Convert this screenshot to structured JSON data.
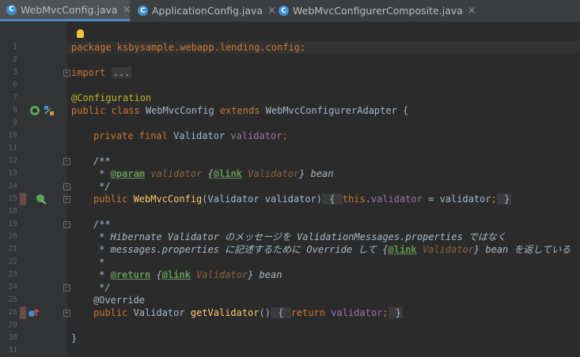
{
  "tabs": [
    {
      "label": "WebMvcConfig.java",
      "active": true,
      "closable": true,
      "icon": "class-icon"
    },
    {
      "label": "ApplicationConfig.java",
      "active": false,
      "closable": true,
      "icon": "class-icon"
    },
    {
      "label": "WebMvcConfigurerComposite.java",
      "active": false,
      "closable": true,
      "icon": "class-icon"
    }
  ],
  "colors": {
    "keyword": "#cc7832",
    "annotation": "#bbb529",
    "field": "#9876aa",
    "method": "#ffc66d",
    "javadoc": "#629755",
    "text": "#a9b7c6",
    "background": "#2b2b2b"
  },
  "line_numbers": [
    "1",
    "2",
    "3",
    "6",
    "7",
    "8",
    "9",
    "10",
    "11",
    "12",
    "13",
    "14",
    "15",
    "18",
    "19",
    "20",
    "21",
    "22",
    "23",
    "24",
    "25",
    "26",
    "29",
    "30",
    "31"
  ],
  "code": {
    "l1": {
      "package_kw": "package",
      "package_name": " ksbysample.webapp.lending.config;"
    },
    "l3": {
      "import_kw": "import",
      "folded": "..."
    },
    "l7": {
      "annotation": "@Configuration"
    },
    "l8": {
      "public": "public",
      "class": " class",
      "name": " WebMvcConfig",
      "extends": " extends",
      "parent": " WebMvcConfigurerAdapter {"
    },
    "l10": {
      "private": "private",
      "final": " final",
      "type": " Validator",
      "field": " validator",
      "semi": ";"
    },
    "l12": {
      "text": "/**"
    },
    "l13": {
      "star": " * ",
      "tag": "@param",
      "param": " validator ",
      "link_open": "{",
      "link_tag": "@link",
      "link_ref": " Validator",
      "link_close": "}",
      "rest": " bean"
    },
    "l14": {
      "text": " */"
    },
    "l15": {
      "public": "public",
      "name": " WebMvcConfig",
      "open": "(Validator ",
      "param": "validator",
      "close": ")",
      "fold_open": " { ",
      "this": "this",
      "dot": ".",
      "field": "validator",
      "eq": " = ",
      "param2": "validator",
      "semi": ";",
      "fold_close": " }"
    },
    "l19": {
      "text": "/**"
    },
    "l20": {
      "text": " * Hibernate Validator のメッセージを ValidationMessages.properties ではなく"
    },
    "l21": {
      "text1": " * messages.properties に記述するために Override して ",
      "link_open": "{",
      "link_tag": "@link",
      "link_ref": " Validator",
      "link_close": "}",
      "rest": " bean を返している"
    },
    "l22": {
      "text": " *"
    },
    "l23": {
      "star": " * ",
      "tag": "@return",
      "space": " ",
      "link_open": "{",
      "link_tag": "@link",
      "link_ref": " Validator",
      "link_close": "}",
      "rest": " bean"
    },
    "l24": {
      "text": " */"
    },
    "l25": {
      "annotation": "@Override"
    },
    "l26": {
      "public": "public",
      "type": " Validator ",
      "name": "getValidator",
      "parens": "()",
      "fold_open": " { ",
      "return": "return",
      "field": " validator",
      "semi": ";",
      "fold_close": " }"
    },
    "l30": {
      "text": "}"
    }
  }
}
